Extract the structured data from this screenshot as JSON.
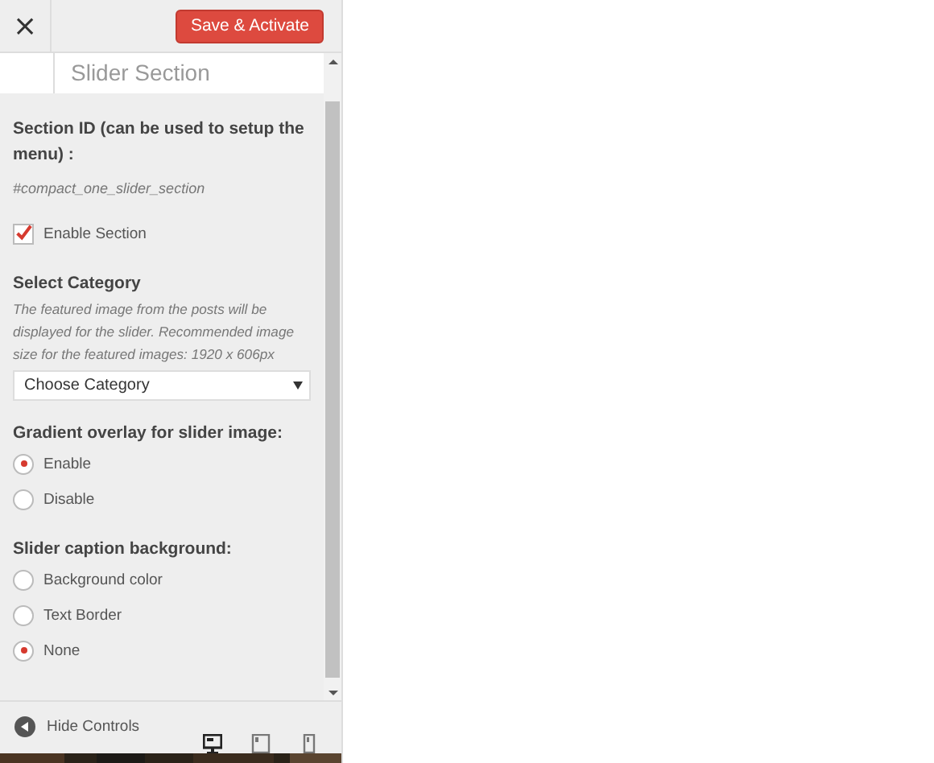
{
  "header": {
    "close": "×",
    "save_button": "Save & Activate"
  },
  "section_title": "Slider Section",
  "controls": [
    {
      "kind": "text",
      "label": "Section ID (can be used to setup the menu) :",
      "value": "#compact_one_slider_section"
    },
    {
      "kind": "checkbox",
      "label": "Enable Section",
      "checked": true
    },
    {
      "kind": "select",
      "label": "Select Category",
      "description": "The featured image from the posts will be displayed for the slider. Recommended image size for the featured images: 1920 x 606px",
      "value": "Choose Category"
    },
    {
      "kind": "radio",
      "label": "Gradient overlay for slider image:",
      "options": [
        {
          "label": "Enable",
          "selected": true
        },
        {
          "label": "Disable",
          "selected": false
        }
      ]
    },
    {
      "kind": "radio",
      "label": "Slider caption background:",
      "options": [
        {
          "label": "Background color",
          "selected": false
        },
        {
          "label": "Text Border",
          "selected": false
        },
        {
          "label": "None",
          "selected": true
        }
      ]
    }
  ],
  "footer": {
    "hide_controls": "Hide Controls",
    "devices": [
      {
        "kind": "desktop",
        "selected": true
      },
      {
        "kind": "tablet",
        "selected": false
      },
      {
        "kind": "mobile",
        "selected": false
      }
    ]
  }
}
